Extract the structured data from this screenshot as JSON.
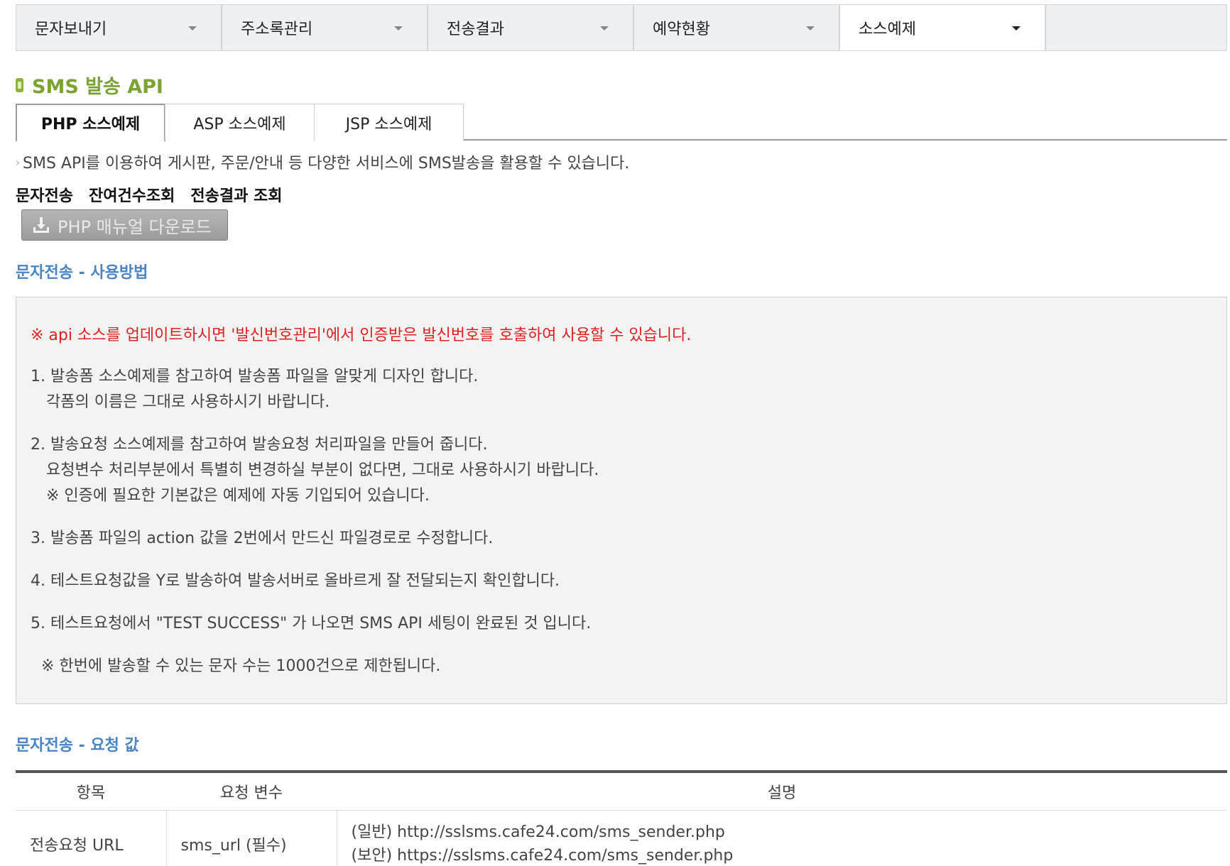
{
  "topnav": {
    "items": [
      {
        "label": "문자보내기"
      },
      {
        "label": "주소록관리"
      },
      {
        "label": "전송결과"
      },
      {
        "label": "예약현황"
      },
      {
        "label": "소스예제"
      }
    ],
    "active_index": 4
  },
  "heading": {
    "title": "SMS 발송 API",
    "bullet_color": "#8cb43c",
    "title_color": "#7aa332"
  },
  "lang_tabs": [
    {
      "label": "PHP 소스예제",
      "active": true
    },
    {
      "label": "ASP 소스예제",
      "active": false
    },
    {
      "label": "JSP 소스예제",
      "active": false
    }
  ],
  "intro": "SMS API를 이용하여 게시판, 주문/안내 등 다양한 서비스에 SMS발송을 활용할 수 있습니다.",
  "sublinks": [
    "문자전송",
    "잔여건수조회",
    "전송결과 조회"
  ],
  "download_button": {
    "label": "PHP 매뉴얼 다운로드",
    "icon": "download-icon"
  },
  "usage": {
    "title": "문자전송 - 사용방법",
    "notice": "※ api 소스를 업데이트하시면 '발신번호관리'에서 인증받은 발신번호를 호출하여 사용할 수 있습니다.",
    "steps": [
      {
        "main": "1. 발송폼 소스예제를 참고하여 발송폼 파일을 알맞게 디자인 합니다.",
        "cont": [
          "각폼의 이름은 그대로 사용하시기 바랍니다."
        ]
      },
      {
        "main": "2. 발송요청 소스예제를 참고하여 발송요청 처리파일을 만들어 줍니다.",
        "cont": [
          "요청변수 처리부분에서 특별히 변경하실 부분이 없다면, 그대로 사용하시기 바랍니다.",
          "※ 인증에 필요한 기본값은 예제에 자동 기입되어 있습니다."
        ]
      },
      {
        "main": "3. 발송폼 파일의 action 값을 2번에서 만드신 파일경로로 수정합니다.",
        "cont": []
      },
      {
        "main": "4. 테스트요청값을 Y로 발송하여 발송서버로 올바르게 잘 전달되는지 확인합니다.",
        "cont": []
      },
      {
        "main": "5. 테스트요청에서 \"TEST SUCCESS\" 가 나오면 SMS API 세팅이 완료된 것 입니다.",
        "cont": []
      }
    ],
    "limit_note": "※ 한번에 발송할 수 있는 문자 수는 1000건으로 제한됩니다."
  },
  "request": {
    "title": "문자전송 - 요청 값",
    "headers": [
      "항목",
      "요청 변수",
      "설명"
    ],
    "rows": [
      {
        "item": "전송요청 URL",
        "var": "sms_url (필수)",
        "desc": [
          "(일반) http://sslsms.cafe24.com/sms_sender.php",
          "(보안) https://sslsms.cafe24.com/sms_sender.php"
        ]
      }
    ]
  },
  "colors": {
    "notice_red": "#e02020",
    "section_blue": "#4a84c5",
    "guide_bg": "#f3f3f3"
  }
}
